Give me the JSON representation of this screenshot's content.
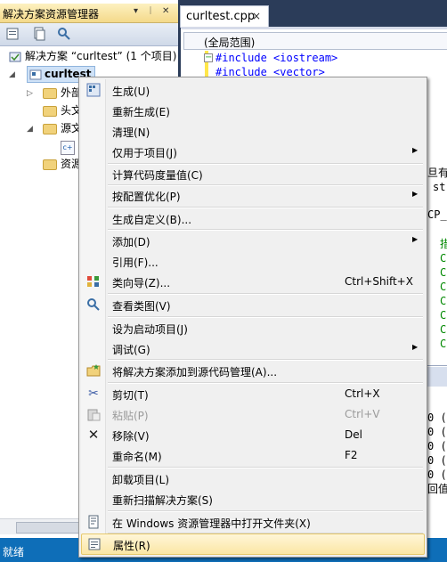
{
  "solution_explorer": {
    "title": "解决方案资源管理器",
    "title_buttons": [
      "▾",
      "ᛁ",
      "✕"
    ],
    "solution_label": "解决方案 “curltest” (1 个项目)",
    "project_label": "curltest",
    "items": [
      "外部",
      "头文",
      "源文",
      "资源"
    ]
  },
  "editor": {
    "tab_label": "curltest.cpp",
    "tab_close": "×",
    "scope_label": "(全局范围)",
    "code_lines": [
      "#include <iostream>",
      "#include <vector>"
    ],
    "right_fragments": [
      "旦有",
      "st",
      "CP_",
      "措",
      "C",
      "C",
      "C",
      "C",
      "C",
      "C",
      "C"
    ],
    "output_fragments": [
      "0  (",
      "0  (",
      "0  (",
      "0  (",
      "0  (",
      "回值"
    ]
  },
  "status_bar": {
    "text": "就绪"
  },
  "context_menu": {
    "items": [
      {
        "label": "生成(U)",
        "icon": "build-icon"
      },
      {
        "label": "重新生成(E)"
      },
      {
        "label": "清理(N)"
      },
      {
        "label": "仅用于项目(J)",
        "submenu": true
      },
      {
        "label": "计算代码度量值(C)"
      },
      {
        "label": "按配置优化(P)",
        "submenu": true
      },
      {
        "label": "生成自定义(B)..."
      },
      {
        "label": "添加(D)",
        "submenu": true
      },
      {
        "label": "引用(F)..."
      },
      {
        "label": "类向导(Z)...",
        "shortcut": "Ctrl+Shift+X",
        "icon": "class-wizard-icon"
      },
      {
        "label": "查看类图(V)",
        "icon": "class-diagram-icon"
      },
      {
        "label": "设为启动项目(J)"
      },
      {
        "label": "调试(G)",
        "submenu": true
      },
      {
        "label": "将解决方案添加到源代码管理(A)...",
        "icon": "source-control-icon"
      },
      {
        "label": "剪切(T)",
        "shortcut": "Ctrl+X",
        "icon": "cut-icon"
      },
      {
        "label": "粘贴(P)",
        "shortcut": "Ctrl+V",
        "icon": "paste-icon",
        "disabled": true
      },
      {
        "label": "移除(V)",
        "shortcut": "Del",
        "icon": "remove-icon"
      },
      {
        "label": "重命名(M)",
        "shortcut": "F2"
      },
      {
        "label": "卸载项目(L)"
      },
      {
        "label": "重新扫描解决方案(S)"
      },
      {
        "label": "在 Windows 资源管理器中打开文件夹(X)",
        "icon": "open-folder-icon"
      },
      {
        "label": "属性(R)",
        "icon": "properties-icon",
        "highlighted": true
      }
    ],
    "submenu_arrow": "▶"
  },
  "colors": {
    "status_bar": "#0e6eb8",
    "menu_highlight": "#fbe6a4",
    "background": "#2b3c59"
  }
}
